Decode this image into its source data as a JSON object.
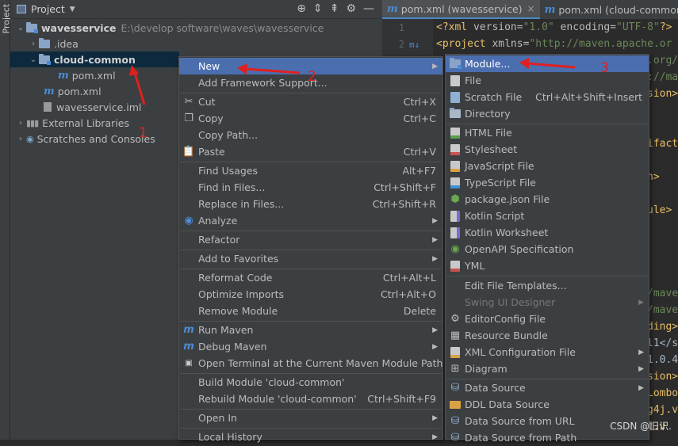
{
  "panel": {
    "strip_label": "Project",
    "title": "Project",
    "toolbar_icons": [
      "crosshair-icon",
      "expand-all-icon",
      "collapse-all-icon",
      "gear-icon",
      "minimize-icon"
    ]
  },
  "tree": {
    "root_name": "wavesservice",
    "root_path": "E:\\develop software\\waves\\wavesservice",
    "idea": ".idea",
    "cloud_common": "cloud-common",
    "cloud_pom": "pom.xml",
    "root_pom": "pom.xml",
    "iml": "wavesservice.iml",
    "ext_libs": "External Libraries",
    "scratches": "Scratches and Consoles"
  },
  "tabs": [
    {
      "label": "pom.xml (wavesservice)",
      "active": true,
      "close": "×"
    },
    {
      "label": "pom.xml (cloud-common)",
      "active": false
    }
  ],
  "editor": {
    "line1": {
      "open": "<?xml",
      "version_attr": " version=",
      "version_val": "\"1.0\"",
      "enc_attr": " encoding=",
      "enc_val": "\"UTF-8\"",
      "close": "?>"
    },
    "line2": {
      "open": "<project",
      "attr": " xmlns=",
      "val": "\"http://maven.apache.or"
    },
    "line_numbers": [
      "1",
      "2"
    ],
    "gutter_mark": "m↓",
    "fragments": [
      ".org/",
      "://ma",
      "sion>",
      "ifact",
      "n>",
      "ule>",
      "/mave",
      "/mave",
      "ding>",
      "l1</s",
      "1.0.4",
      "sion>",
      "Lombo",
      "g4j.v",
      "t.v"
    ]
  },
  "main_menu": {
    "items": [
      {
        "label": "New",
        "has_sub": true,
        "highlight": true
      },
      {
        "label": "Add Framework Support..."
      },
      {
        "label": "Cut",
        "shortcut": "Ctrl+X",
        "icon": "scissors-icon"
      },
      {
        "label": "Copy",
        "shortcut": "Ctrl+C",
        "icon": "copy-icon"
      },
      {
        "label": "Copy Path..."
      },
      {
        "label": "Paste",
        "shortcut": "Ctrl+V",
        "icon": "paste-icon"
      },
      {
        "label": "Find Usages",
        "shortcut": "Alt+F7"
      },
      {
        "label": "Find in Files...",
        "shortcut": "Ctrl+Shift+F"
      },
      {
        "label": "Replace in Files...",
        "shortcut": "Ctrl+Shift+R"
      },
      {
        "label": "Analyze",
        "has_sub": true,
        "icon": "analyze-icon"
      },
      {
        "label": "Refactor",
        "has_sub": true
      },
      {
        "label": "Add to Favorites",
        "has_sub": true
      },
      {
        "label": "Reformat Code",
        "shortcut": "Ctrl+Alt+L"
      },
      {
        "label": "Optimize Imports",
        "shortcut": "Ctrl+Alt+O"
      },
      {
        "label": "Remove Module",
        "shortcut": "Delete"
      },
      {
        "label": "Run Maven",
        "has_sub": true,
        "icon": "maven-run-icon"
      },
      {
        "label": "Debug Maven",
        "has_sub": true,
        "icon": "maven-debug-icon"
      },
      {
        "label": "Open Terminal at the Current Maven Module Path",
        "icon": "terminal-icon"
      },
      {
        "label": "Build Module 'cloud-common'"
      },
      {
        "label": "Rebuild Module 'cloud-common'",
        "shortcut": "Ctrl+Shift+F9"
      },
      {
        "label": "Open In",
        "has_sub": true
      },
      {
        "label": "Local History",
        "has_sub": true
      }
    ]
  },
  "new_menu": {
    "items": [
      {
        "label": "Module...",
        "highlight": true,
        "icon": "module-icon"
      },
      {
        "label": "File",
        "icon": "file-icon"
      },
      {
        "label": "Scratch File",
        "shortcut": "Ctrl+Alt+Shift+Insert",
        "icon": "scratch-file-icon"
      },
      {
        "label": "Directory",
        "icon": "directory-icon"
      },
      {
        "label": "HTML File",
        "icon": "html-file-icon"
      },
      {
        "label": "Stylesheet",
        "icon": "css-file-icon"
      },
      {
        "label": "JavaScript File",
        "icon": "js-file-icon"
      },
      {
        "label": "TypeScript File",
        "icon": "ts-file-icon"
      },
      {
        "label": "package.json File",
        "icon": "package-json-icon"
      },
      {
        "label": "Kotlin Script",
        "icon": "kotlin-script-icon"
      },
      {
        "label": "Kotlin Worksheet",
        "icon": "kotlin-worksheet-icon"
      },
      {
        "label": "OpenAPI Specification",
        "icon": "openapi-icon"
      },
      {
        "label": "YML",
        "icon": "yml-icon"
      },
      {
        "label": "Edit File Templates..."
      },
      {
        "label": "Swing UI Designer",
        "has_sub": true,
        "disabled": true
      },
      {
        "label": "EditorConfig File",
        "icon": "editorconfig-icon"
      },
      {
        "label": "Resource Bundle",
        "icon": "resource-bundle-icon"
      },
      {
        "label": "XML Configuration File",
        "has_sub": true,
        "icon": "xml-config-icon"
      },
      {
        "label": "Diagram",
        "has_sub": true,
        "icon": "diagram-icon"
      },
      {
        "label": "Data Source",
        "has_sub": true,
        "icon": "data-source-icon"
      },
      {
        "label": "DDL Data Source",
        "icon": "ddl-icon"
      },
      {
        "label": "Data Source from URL",
        "icon": "data-source-url-icon"
      },
      {
        "label": "Data Source from Path",
        "icon": "data-source-path-icon"
      }
    ]
  },
  "annotations": {
    "one": "1",
    "two": "2",
    "three": "3",
    "color": "#e02020"
  },
  "watermark": "CSDN @旧识."
}
